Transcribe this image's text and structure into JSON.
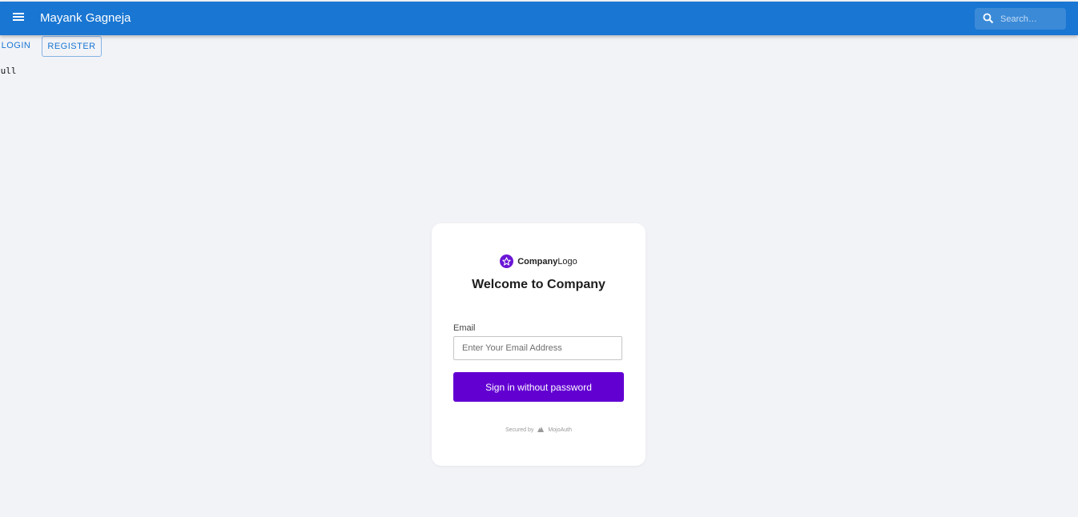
{
  "appbar": {
    "title": "Mayank Gagneja",
    "menu_icon": "hamburger-menu-icon",
    "search": {
      "placeholder": "Search…",
      "icon": "search-icon"
    },
    "color": "#1976d2"
  },
  "nav": {
    "login_label": "LOGIN",
    "register_label": "REGISTER"
  },
  "debug_text": "null",
  "card": {
    "logo": {
      "bold": "Company",
      "regular": "Logo",
      "icon": "star-badge-icon",
      "color": "#6b16d6"
    },
    "heading": "Welcome to Company",
    "email_label": "Email",
    "email_placeholder": "Enter Your Email Address",
    "email_value": "",
    "submit_label": "Sign in without password",
    "submit_color": "#6200d2",
    "footer": {
      "secured_by": "Secured by",
      "brand": "MojoAuth",
      "brand_icon": "mojoauth-logo-icon"
    }
  }
}
